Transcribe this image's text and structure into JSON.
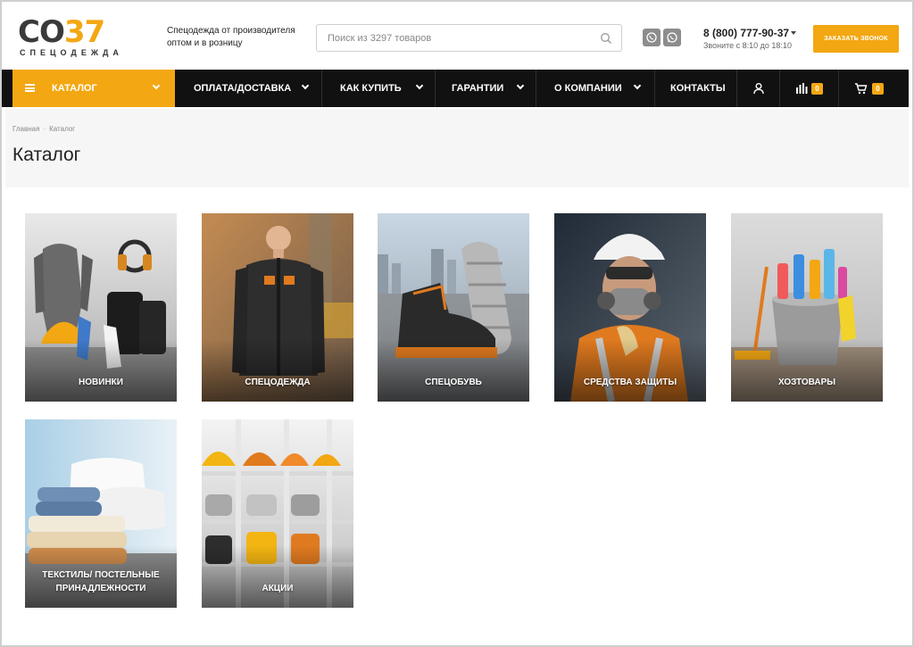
{
  "header": {
    "logo_main": "CO37",
    "logo_sub": "СПЕЦОДЕЖДА",
    "tagline": "Спецодежда от производителя оптом и в розницу",
    "search_placeholder": "Поиск из 3297 товаров",
    "phone": "8 (800) 777-90-37",
    "hours": "Звоните с 8:10 до 18:10",
    "callback_label": "ЗАКАЗАТЬ ЗВОНОК",
    "icons": [
      "viber-icon",
      "whatsapp-icon",
      "search-icon"
    ]
  },
  "nav": {
    "catalog": "КАТАЛОГ",
    "items": [
      {
        "label": "ОПЛАТА/ДОСТАВКА"
      },
      {
        "label": "КАК КУПИТЬ"
      },
      {
        "label": "ГАРАНТИИ"
      },
      {
        "label": "О КОМПАНИИ"
      },
      {
        "label": "КОНТАКТЫ"
      }
    ],
    "compare_count": "0",
    "cart_count": "0",
    "icons": [
      "menu-icon",
      "user-icon",
      "compare-icon",
      "cart-icon"
    ]
  },
  "breadcrumb": {
    "home": "Главная",
    "current": "Каталог"
  },
  "page_title": "Каталог",
  "categories": [
    {
      "label": "НОВИНКИ"
    },
    {
      "label": "СПЕЦОДЕЖДА"
    },
    {
      "label": "СПЕЦОБУВЬ"
    },
    {
      "label": "СРЕДСТВА ЗАЩИТЫ"
    },
    {
      "label": "ХОЗТОВАРЫ"
    },
    {
      "label": "ТЕКСТИЛЬ/ ПОСТЕЛЬНЫЕ ПРИНАДЛЕЖНОСТИ"
    },
    {
      "label": "АКЦИИ"
    }
  ],
  "colors": {
    "accent": "#f3a712",
    "nav_bg": "#111111",
    "title_bg": "#f6f6f6"
  }
}
